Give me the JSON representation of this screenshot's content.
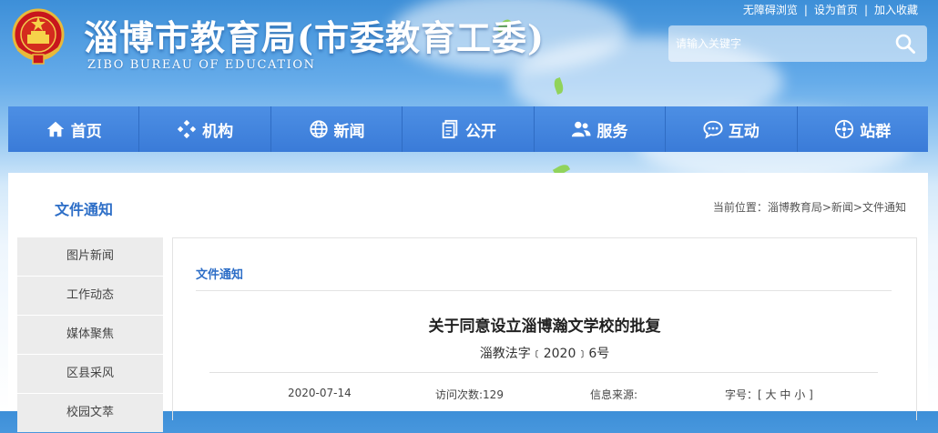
{
  "header": {
    "title_cn": "淄博市教育局(市委教育工委)",
    "title_en": "ZIBO BUREAU OF EDUCATION",
    "top_links": [
      "无障碍浏览",
      "设为首页",
      "加入收藏"
    ],
    "search_placeholder": "请输入关键字",
    "icon_emblem": "national-emblem-icon",
    "icon_search": "search-icon"
  },
  "nav": {
    "items": [
      {
        "label": "首页",
        "icon": "home-icon"
      },
      {
        "label": "机构",
        "icon": "diamond-grid-icon"
      },
      {
        "label": "新闻",
        "icon": "globe-icon"
      },
      {
        "label": "公开",
        "icon": "documents-icon"
      },
      {
        "label": "服务",
        "icon": "users-icon"
      },
      {
        "label": "互动",
        "icon": "chat-bubble-icon"
      },
      {
        "label": "站群",
        "icon": "compass-icon"
      }
    ]
  },
  "section": {
    "title": "文件通知",
    "breadcrumb_prefix": "当前位置：",
    "breadcrumb": [
      "淄博教育局",
      "新闻",
      "文件通知"
    ],
    "breadcrumb_sep": ">"
  },
  "sidebar": {
    "items": [
      "图片新闻",
      "工作动态",
      "媒体聚焦",
      "区县采风",
      "校园文萃"
    ]
  },
  "article": {
    "category": "文件通知",
    "title": "关于同意设立淄博瀚文学校的批复",
    "doc_number": "淄教法字﹝2020﹞6号",
    "date": "2020-07-14",
    "visits_label": "访问次数:",
    "visits": "129",
    "source_label": "信息来源:",
    "source": "",
    "font_label": "字号：",
    "font_open": "[",
    "font_large": "大",
    "font_medium": "中",
    "font_small": "小",
    "font_close": "]"
  },
  "colors": {
    "nav_blue": "#3a7bd8",
    "accent": "#2d6ec7",
    "sidebar_bg": "#ececec"
  }
}
